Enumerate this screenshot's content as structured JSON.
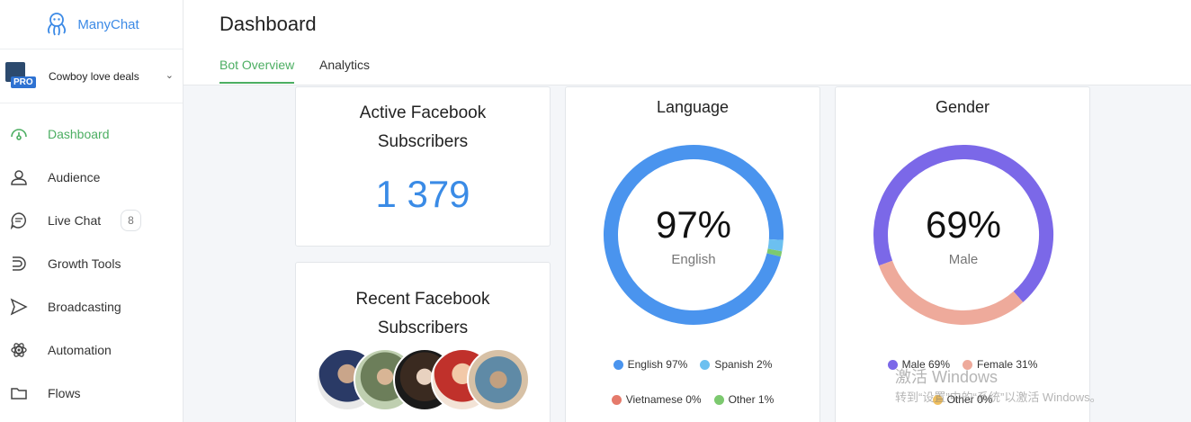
{
  "app": {
    "name": "ManyChat"
  },
  "account": {
    "name": "Cowboy love deals",
    "badge": "PRO"
  },
  "sidebar": {
    "items": [
      {
        "label": "Dashboard",
        "icon": "dashboard-icon",
        "active": true
      },
      {
        "label": "Audience",
        "icon": "person-icon"
      },
      {
        "label": "Live Chat",
        "icon": "chat-icon",
        "badge": "8"
      },
      {
        "label": "Growth Tools",
        "icon": "growth-icon"
      },
      {
        "label": "Broadcasting",
        "icon": "send-icon"
      },
      {
        "label": "Automation",
        "icon": "atom-icon"
      },
      {
        "label": "Flows",
        "icon": "folder-icon"
      }
    ]
  },
  "header": {
    "title": "Dashboard",
    "tabs": [
      {
        "label": "Bot Overview",
        "active": true
      },
      {
        "label": "Analytics"
      }
    ]
  },
  "active_subscribers": {
    "title_line1": "Active Facebook",
    "title_line2": "Subscribers",
    "value": "1 379"
  },
  "recent_subscribers": {
    "title_line1": "Recent Facebook",
    "title_line2": "Subscribers"
  },
  "language": {
    "title": "Language",
    "center_pct": "97%",
    "center_label": "English",
    "legend": [
      {
        "label": "English 97%",
        "color": "#4a94ee",
        "value": 97
      },
      {
        "label": "Spanish 2%",
        "color": "#6cc0f0",
        "value": 2
      },
      {
        "label": "Vietnamese 0%",
        "color": "#e57a6b",
        "value": 0
      },
      {
        "label": "Other 1%",
        "color": "#7cc96f",
        "value": 1
      }
    ]
  },
  "gender": {
    "title": "Gender",
    "center_pct": "69%",
    "center_label": "Male",
    "legend": [
      {
        "label": "Male 69%",
        "color": "#7b68e8",
        "value": 69
      },
      {
        "label": "Female 31%",
        "color": "#eeaa9b",
        "value": 31
      },
      {
        "label": "Other 0%",
        "color": "#f0c060",
        "value": 0
      }
    ]
  },
  "watermark": {
    "line1": "激活 Windows",
    "line2": "转到“设置”中的“系统”以激活 Windows。"
  }
}
